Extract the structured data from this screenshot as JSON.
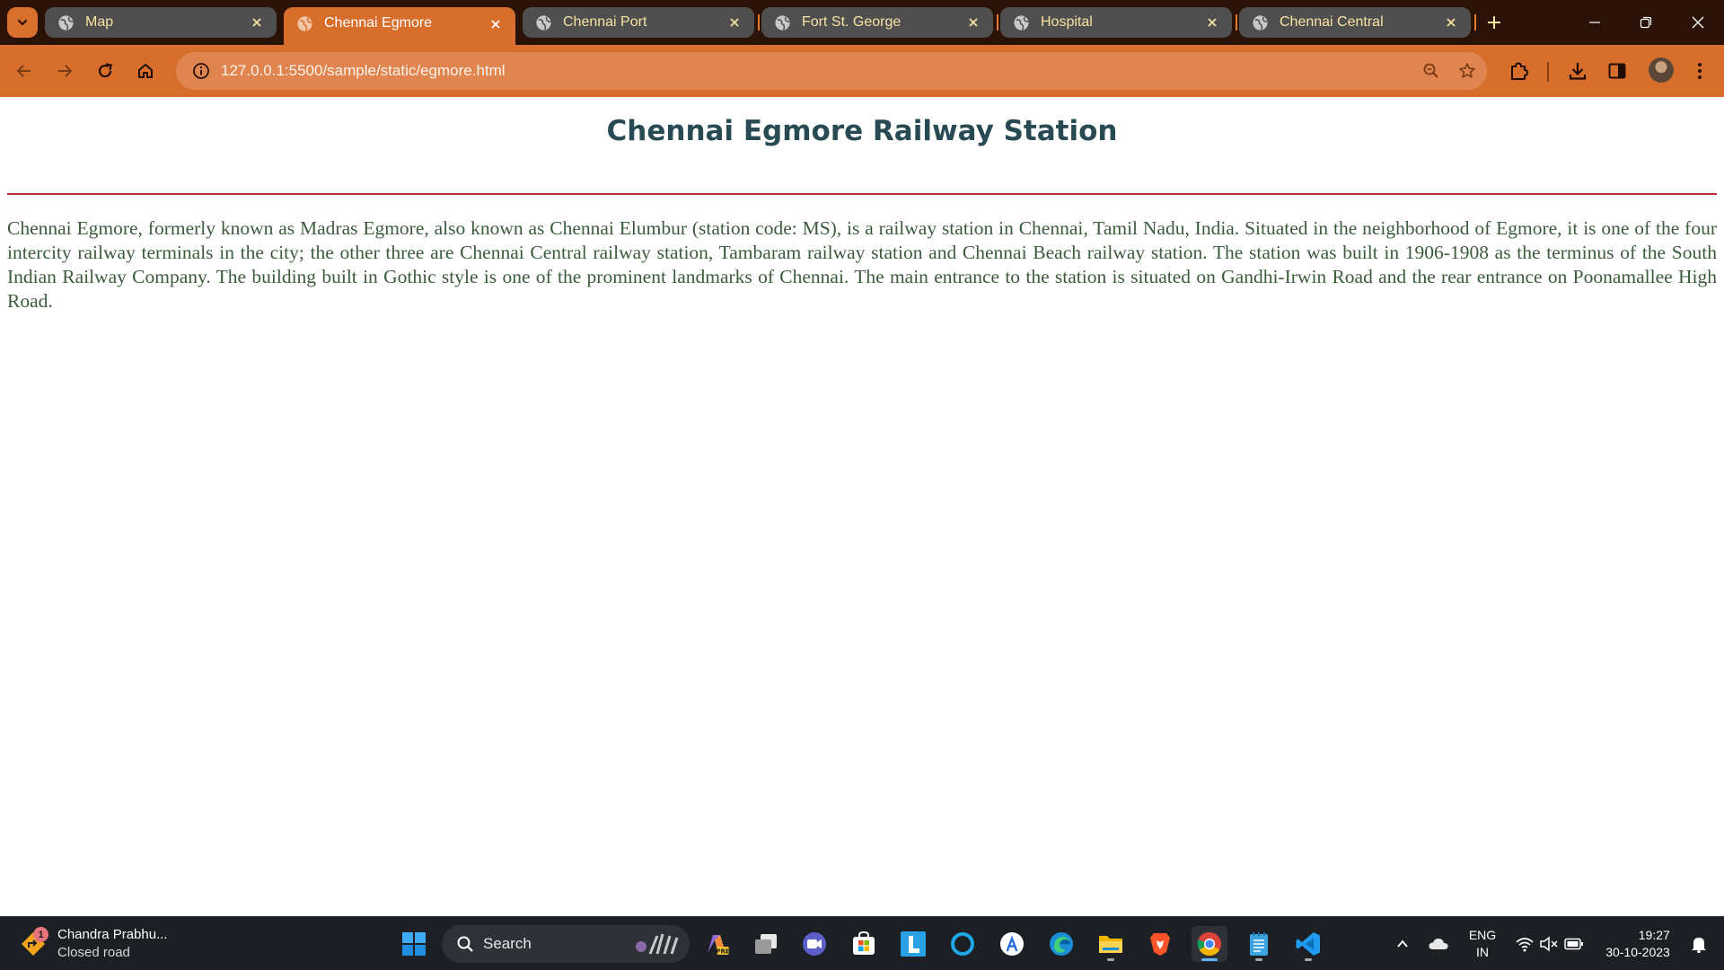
{
  "browser": {
    "tabs": [
      {
        "title": "Map",
        "active": false
      },
      {
        "title": "Chennai Egmore",
        "active": true
      },
      {
        "title": "Chennai Port",
        "active": false
      },
      {
        "title": "Fort St. George",
        "active": false
      },
      {
        "title": "Hospital",
        "active": false
      },
      {
        "title": "Chennai Central",
        "active": false
      }
    ],
    "address_bar": {
      "url": "127.0.0.1:5500/sample/static/egmore.html"
    },
    "theme_colors": {
      "frame": "#2a1206",
      "toolbar": "#d86e2b",
      "inactive_tab": "#4f4f4f",
      "tab_text": "#f7e2a2"
    }
  },
  "page": {
    "heading": "Chennai Egmore Railway Station",
    "body": "Chennai Egmore, formerly known as Madras Egmore, also known as Chennai Elumbur (station code: MS), is a railway station in Chennai, Tamil Nadu, India. Situated in the neighborhood of Egmore, it is one of the four intercity railway terminals in the city; the other three are Chennai Central railway station, Tambaram railway station and Chennai Beach railway station. The station was built in 1906-1908 as the terminus of the South Indian Railway Company. The building built in Gothic style is one of the prominent landmarks of Chennai. The main entrance to the station is situated on Gandhi-Irwin Road and the rear entrance on Poonamallee High Road.",
    "colors": {
      "heading": "#284b53",
      "rule": "#b93535",
      "body_text": "#3c5b3c"
    }
  },
  "taskbar": {
    "weather": {
      "badge": "1",
      "title": "Chandra Prabhu...",
      "subtitle": "Closed road"
    },
    "search": {
      "label": "Search"
    },
    "apps": [
      "start-icon",
      "copilot-icon",
      "task-view-icon",
      "teams-meet-icon",
      "microsoft-store-icon",
      "l-app-icon",
      "cortana-icon",
      "app-store-icon",
      "edge-icon",
      "file-explorer-icon",
      "brave-icon",
      "chrome-icon",
      "notepad-icon",
      "vscode-icon"
    ],
    "tray": {
      "language_line1": "ENG",
      "language_line2": "IN",
      "time": "19:27",
      "date": "30-10-2023"
    }
  }
}
